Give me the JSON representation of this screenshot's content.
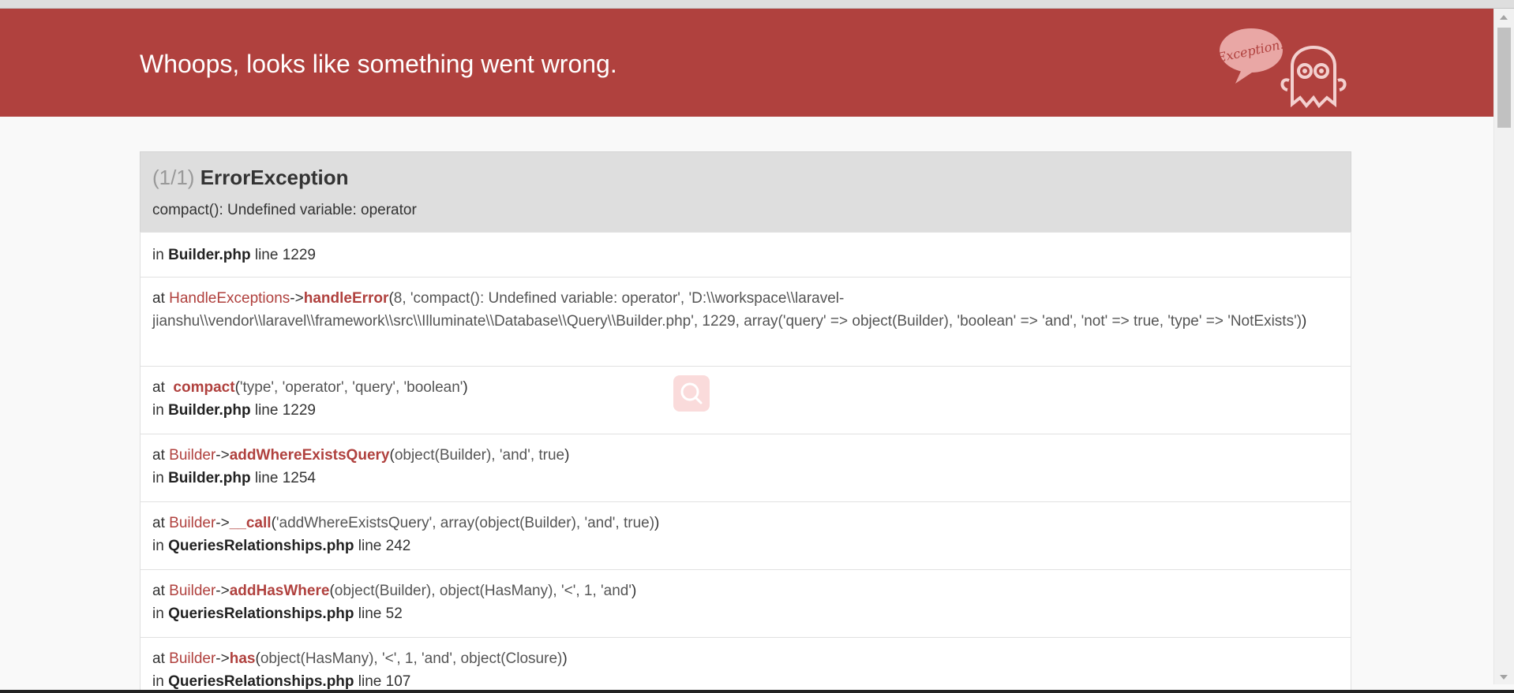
{
  "header": {
    "title": "Whoops, looks like something went wrong.",
    "mascot_label": "Exception!",
    "bg_color": "#b0413e"
  },
  "exception": {
    "count": "(1/1)",
    "class": "ErrorException",
    "message": "compact(): Undefined variable: operator"
  },
  "trace": [
    {
      "type": "in",
      "prefix": "in",
      "file": "Builder.php",
      "line_label": "line",
      "line": "1229"
    },
    {
      "type": "frame",
      "prefix": "at",
      "class": "HandleExceptions",
      "arrow": "->",
      "function": "handleError",
      "args_plain": "8, 'compact(): Undefined variable: operator', 'D:\\\\workspace\\\\laravel-jianshu\\\\vendor\\\\laravel\\\\framework\\\\src\\\\Illuminate\\\\Database\\\\Query\\\\Builder.php', 1229, ",
      "args_rest": "array('query' => object(Builder), 'boolean' => 'and', 'not' => true, 'type' => 'NotExists')"
    },
    {
      "type": "frame",
      "prefix": "at",
      "class": "",
      "arrow": "",
      "function": "compact",
      "args": "'type', 'operator', 'query', 'boolean'",
      "file": "Builder.php",
      "line": "1229"
    },
    {
      "type": "frame",
      "prefix": "at",
      "class": "Builder",
      "arrow": "->",
      "function": "addWhereExistsQuery",
      "args": "object(Builder), 'and', true",
      "file": "Builder.php",
      "line": "1254"
    },
    {
      "type": "frame",
      "prefix": "at",
      "class": "Builder",
      "arrow": "->",
      "function": "__call",
      "args": "'addWhereExistsQuery', array(object(Builder), 'and', true)",
      "file": "QueriesRelationships.php",
      "line": "242"
    },
    {
      "type": "frame",
      "prefix": "at",
      "class": "Builder",
      "arrow": "->",
      "function": "addHasWhere",
      "args": "object(Builder), object(HasMany), '<', 1, 'and'",
      "file": "QueriesRelationships.php",
      "line": "52"
    },
    {
      "type": "frame",
      "prefix": "at",
      "class": "Builder",
      "arrow": "->",
      "function": "has",
      "args": "object(HasMany), '<', 1, 'and', object(Closure)",
      "file": "QueriesRelationships.php",
      "line": "107"
    }
  ]
}
